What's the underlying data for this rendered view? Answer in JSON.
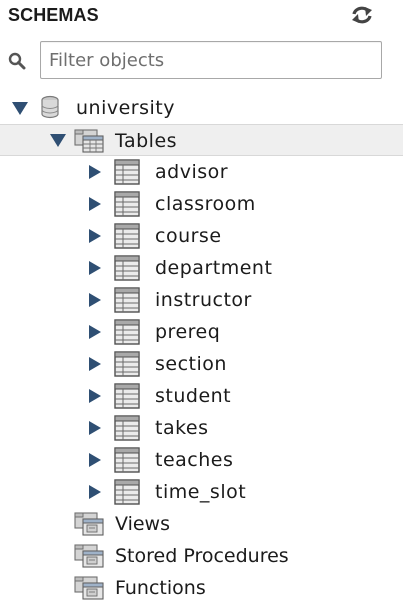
{
  "panel": {
    "title": "SCHEMAS",
    "refresh_icon": "refresh-icon"
  },
  "search": {
    "placeholder": "Filter objects",
    "value": "",
    "icon": "magnifier-icon"
  },
  "schema": {
    "name": "university",
    "expanded": true,
    "icon": "database-icon"
  },
  "tables_group": {
    "label": "Tables",
    "expanded": true,
    "icon": "tables-folder-icon",
    "items": [
      {
        "name": "advisor"
      },
      {
        "name": "classroom"
      },
      {
        "name": "course"
      },
      {
        "name": "department"
      },
      {
        "name": "instructor"
      },
      {
        "name": "prereq"
      },
      {
        "name": "section"
      },
      {
        "name": "student"
      },
      {
        "name": "takes"
      },
      {
        "name": "teaches"
      },
      {
        "name": "time_slot"
      }
    ]
  },
  "other_groups": [
    {
      "label": "Views",
      "icon": "views-folder-icon"
    },
    {
      "label": "Stored Procedures",
      "icon": "procedures-folder-icon"
    },
    {
      "label": "Functions",
      "icon": "functions-folder-icon"
    }
  ],
  "colors": {
    "arrow": "#2f4f73",
    "selected_row": "#efefef",
    "text": "#1b1b1b"
  }
}
